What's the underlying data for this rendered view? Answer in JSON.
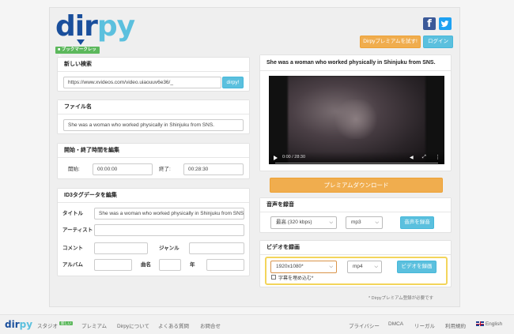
{
  "header": {
    "logo_text": "dirpy",
    "logo_tagline": "ブックマークレット",
    "premium_trial_button": "Dirpyプレミアムを試す!",
    "login_button": "ログイン",
    "facebook_icon": "facebook-icon",
    "twitter_icon": "twitter-icon"
  },
  "search": {
    "title": "新しい検索",
    "url_value": "https://www.xvideos.com/video.uiaouuv6e36/_",
    "submit_label": "dirpy!"
  },
  "filename": {
    "title": "ファイル名",
    "value": "She was a woman who worked physically in Shinjuku from SNS."
  },
  "time_edit": {
    "title": "開始・終了時間を編集",
    "start_label": "開始:",
    "start_value": "00:00:00",
    "end_label": "終了:",
    "end_value": "00:28:30"
  },
  "id3": {
    "title": "ID3タグデータを編集",
    "title_label": "タイトル",
    "title_value": "She was a woman who worked physically in Shinjuku from SNS.",
    "artist_label": "アーティスト",
    "artist_value": "",
    "comment_label": "コメント",
    "comment_value": "",
    "genre_label": "ジャンル",
    "genre_value": "",
    "album_label": "アルバム",
    "album_value": "",
    "track_label": "曲名",
    "track_value": "",
    "year_label": "年",
    "year_value": ""
  },
  "preview": {
    "title": "She was a woman who worked physically in Shinjuku from SNS.",
    "time_display": "0:00 / 28:30",
    "progress": 0
  },
  "premium_download_button": "プレミアムダウンロード",
  "audio": {
    "title": "音声を録音",
    "quality_value": "最高 (320 kbps)",
    "format_value": "mp3",
    "record_button": "音声を録音"
  },
  "video": {
    "title": "ビデオを録画",
    "resolution_value": "1920x1080*",
    "format_value": "mp4",
    "record_button": "ビデオを録画",
    "subtitle_checkbox_label": "字幕を埋め込む*"
  },
  "premium_note": "* Dirpyプレミアム登録が必要です",
  "footer": {
    "logo_text": "dirpy",
    "studio_label": "スタジオ",
    "new_badge": "新しい",
    "premium_label": "プレミアム",
    "about_label": "Dirpyについて",
    "faq_label": "よくある質問",
    "contact_label": "お問合せ",
    "privacy_label": "プライバシー",
    "dmca_label": "DMCA",
    "legal_label": "リーガル",
    "terms_label": "利用規約",
    "language_label": "English"
  },
  "colors": {
    "accent_blue": "#5bc0de",
    "accent_orange": "#f0ad4e",
    "logo_blue": "#1a4f9c",
    "logo_green": "#5cb85c",
    "highlight_yellow": "#f3d55b"
  }
}
